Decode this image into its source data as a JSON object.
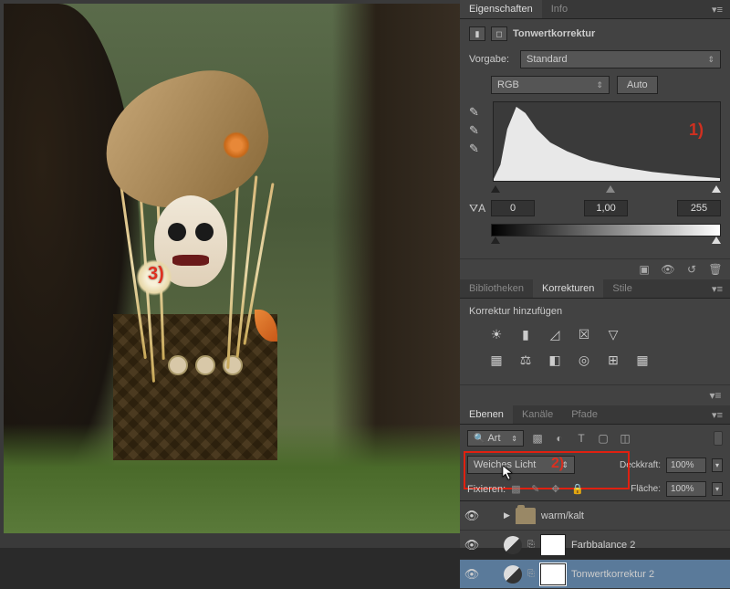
{
  "tabs": {
    "properties": {
      "eigenschaften": "Eigenschaften",
      "info": "Info"
    },
    "korrekturen": {
      "bibliotheken": "Bibliotheken",
      "korrekturen": "Korrekturen",
      "stile": "Stile"
    },
    "layers": {
      "ebenen": "Ebenen",
      "kanaele": "Kanäle",
      "pfade": "Pfade"
    }
  },
  "properties": {
    "title": "Tonwertkorrektur",
    "preset_label": "Vorgabe:",
    "preset_value": "Standard",
    "channel": "RGB",
    "auto": "Auto",
    "levels": {
      "black": "0",
      "gamma": "1,00",
      "white": "255"
    },
    "annotation1": "1)"
  },
  "korrekturen": {
    "add_label": "Korrektur hinzufügen"
  },
  "layers": {
    "search_label": "Art",
    "blend_mode": "Weiches Licht",
    "opacity_label": "Deckkraft:",
    "opacity_value": "100%",
    "fill_label": "Fläche:",
    "fill_value": "100%",
    "lock_label": "Fixieren:",
    "annotation2": "2)",
    "items": [
      {
        "name": "warm/kalt",
        "type": "folder"
      },
      {
        "name": "Farbbalance 2",
        "type": "adjustment"
      },
      {
        "name": "Tonwertkorrektur 2",
        "type": "adjustment",
        "selected": true
      }
    ]
  },
  "canvas": {
    "annotation3": "3)"
  },
  "chart_data": {
    "type": "area",
    "title": "",
    "xlabel": "",
    "ylabel": "",
    "x": [
      0,
      15,
      25,
      35,
      50,
      70,
      100,
      140,
      180,
      220,
      255
    ],
    "values": [
      5,
      60,
      95,
      80,
      55,
      38,
      25,
      15,
      8,
      4,
      2
    ],
    "xlim": [
      0,
      255
    ],
    "ylim": [
      0,
      100
    ],
    "input_levels": {
      "black": 0,
      "gamma": 1.0,
      "white": 255
    }
  }
}
